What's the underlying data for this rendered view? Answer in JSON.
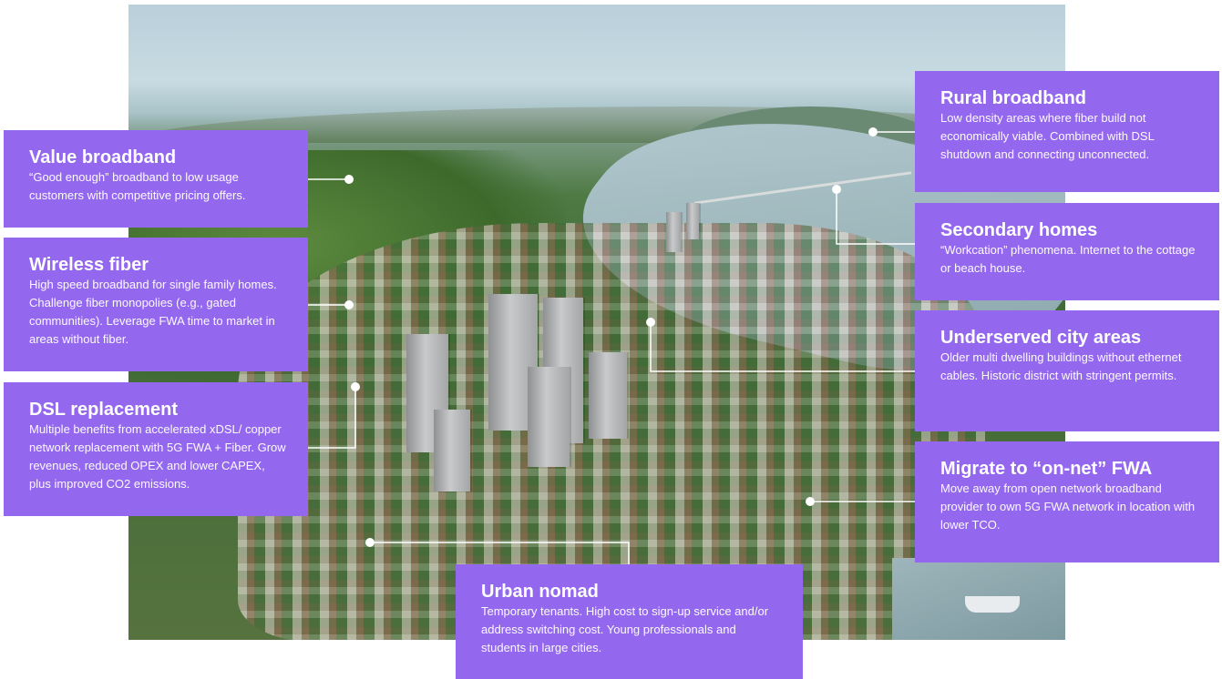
{
  "colors": {
    "box_background": "#9467ef",
    "text": "#ffffff",
    "connector": "#ffffff"
  },
  "segments": [
    {
      "id": "value-broadband",
      "title": "Value broadband",
      "description": "“Good enough” broadband to low usage customers with competitive pricing offers."
    },
    {
      "id": "wireless-fiber",
      "title": "Wireless fiber",
      "description": "High speed broadband for single family homes. Challenge fiber monopolies (e.g., gated communities). Leverage FWA time to market in areas without fiber."
    },
    {
      "id": "dsl-replacement",
      "title": "DSL replacement",
      "description": "Multiple benefits from accelerated xDSL/ copper network replacement with 5G FWA + Fiber. Grow revenues, reduced OPEX and lower CAPEX, plus improved CO2 emissions."
    },
    {
      "id": "urban-nomad",
      "title": "Urban nomad",
      "description": "Temporary tenants. High cost to sign-up service and/or address switching cost. Young professionals and students in large cities."
    },
    {
      "id": "rural-broadband",
      "title": "Rural broadband",
      "description": "Low density areas where fiber build not economically viable. Combined with DSL shutdown and connecting unconnected."
    },
    {
      "id": "secondary-homes",
      "title": "Secondary homes",
      "description": "“Workcation” phenomena. Internet to the cottage or beach house."
    },
    {
      "id": "underserved-city-areas",
      "title": "Underserved city areas",
      "description": "Older multi dwelling buildings without ethernet cables. Historic district with stringent permits."
    },
    {
      "id": "migrate-on-net-fwa",
      "title": "Migrate to “on-net” FWA",
      "description": "Move away from open network broadband provider to own 5G FWA network in location with lower TCO."
    }
  ]
}
